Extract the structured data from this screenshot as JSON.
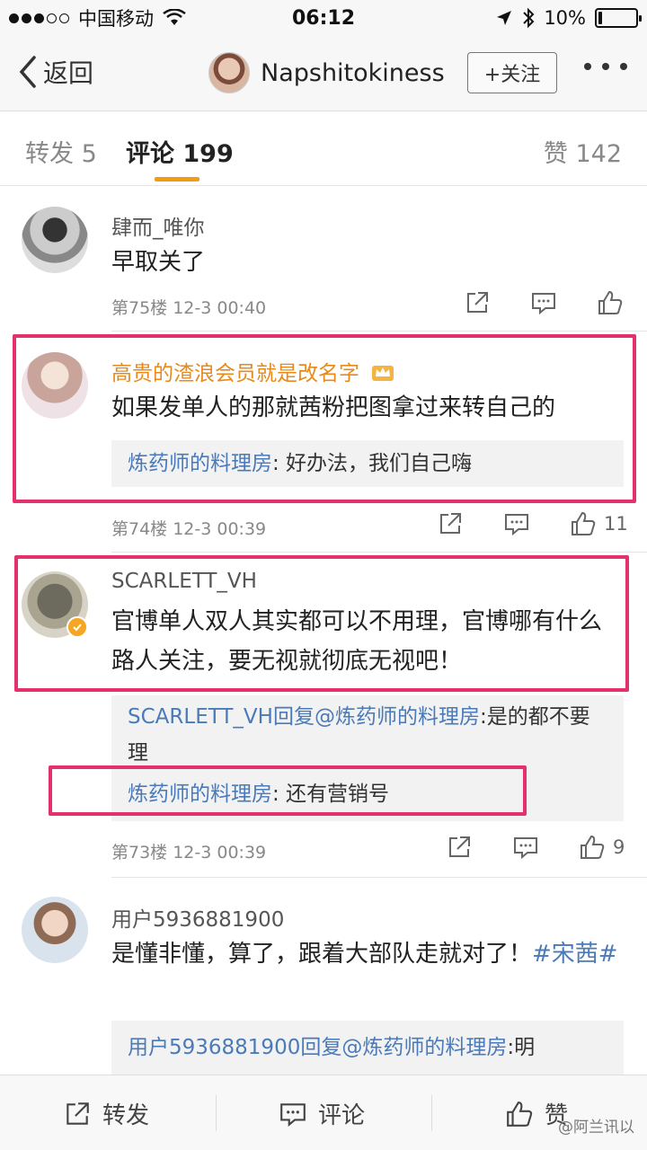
{
  "status_bar": {
    "carrier": "中国移动",
    "time": "06:12",
    "battery": "10%",
    "battery_level": 0.1
  },
  "nav": {
    "back_label": "返回",
    "profile_name": "Napshitokiness",
    "follow_label": "+关注"
  },
  "tabs": {
    "repost": "转发 5",
    "comments": "评论 199",
    "likes": "赞 142"
  },
  "comments": [
    {
      "user": "肆而_唯你",
      "text": "早取关了",
      "meta": "第75楼 12-3 00:40",
      "likes": ""
    },
    {
      "user": "高贵的渣浪会员就是改名字",
      "text": "如果发单人的那就茜粉把图拿过来转自己的",
      "reply_user": "炼药师的料理房",
      "reply_text": ": 好办法，我们自己嗨",
      "meta": "第74楼 12-3 00:39",
      "likes": "11"
    },
    {
      "user": "SCARLETT_VH",
      "text": "官博单人双人其实都可以不用理，官博哪有什么路人关注，要无视就彻底无视吧！",
      "reply1_user": "SCARLETT_VH回复@炼药师的料理房",
      "reply1_text": ":是的都不要理",
      "reply2_user": "炼药师的料理房",
      "reply2_text": ": 还有营销号",
      "meta": "第73楼 12-3 00:39",
      "likes": "9"
    },
    {
      "user": "用户5936881900",
      "text": "是懂非懂，算了，跟着大部队走就对了！",
      "topic": "#宋茜#",
      "reply_user": "用户5936881900回复@炼药师的料理房",
      "reply_text": ":明"
    }
  ],
  "bottom_bar": {
    "repost": "转发",
    "comment": "评论",
    "like": "赞"
  },
  "watermark": "@阿兰讯以",
  "colors": {
    "highlight": "#e4306b",
    "accent": "#f39c12",
    "link": "#4a7ab8",
    "vip": "#e88a1a"
  }
}
